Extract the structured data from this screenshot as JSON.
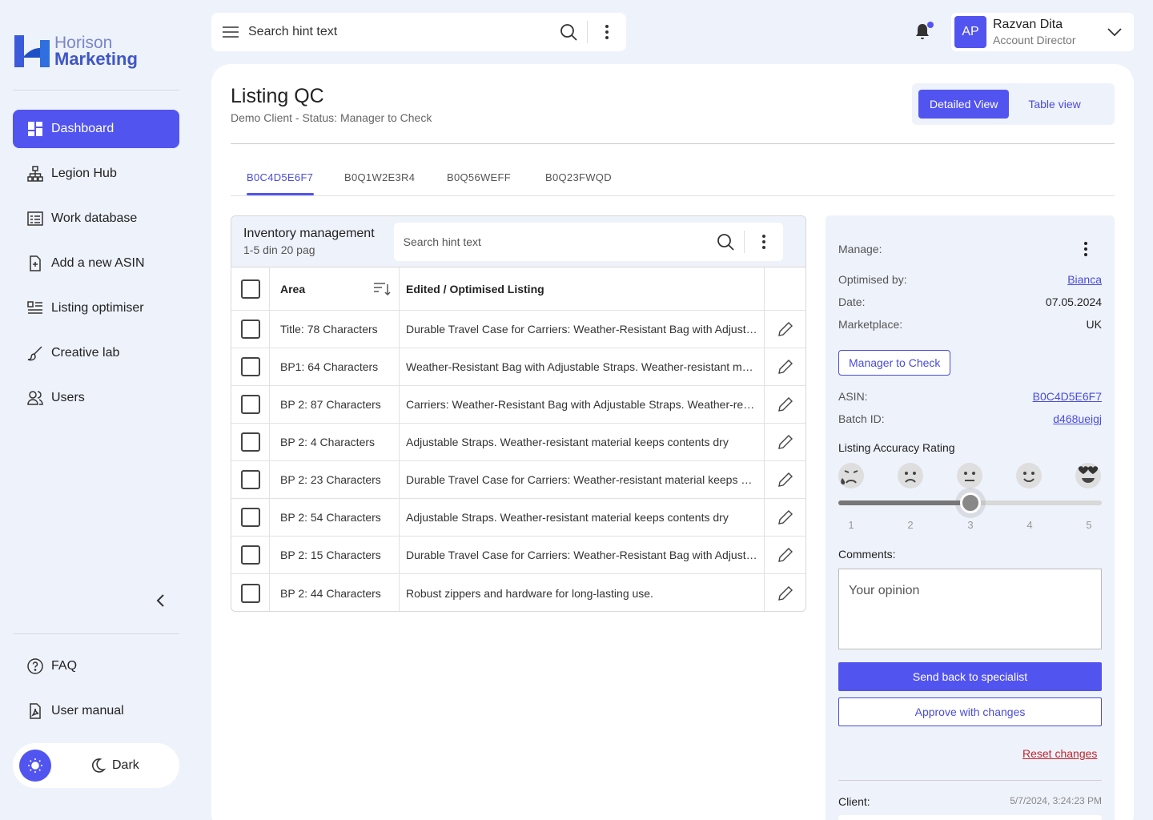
{
  "brand": {
    "line1": "Horison",
    "line2": "Marketing"
  },
  "sidebar": {
    "items": [
      {
        "label": "Dashboard",
        "icon": "dashboard-icon",
        "active": true
      },
      {
        "label": "Legion Hub",
        "icon": "hierarchy-icon"
      },
      {
        "label": "Work database",
        "icon": "database-icon"
      },
      {
        "label": "Add a new ASIN",
        "icon": "file-add-icon"
      },
      {
        "label": "Listing optimiser",
        "icon": "list-icon"
      },
      {
        "label": "Creative lab",
        "icon": "brush-icon"
      },
      {
        "label": "Users",
        "icon": "users-icon"
      }
    ],
    "bottom": [
      {
        "label": "FAQ",
        "icon": "help-icon"
      },
      {
        "label": "User manual",
        "icon": "pdf-icon"
      }
    ],
    "theme": {
      "dark_label": "Dark"
    }
  },
  "topbar": {
    "search_placeholder": "Search hint text",
    "user": {
      "initials": "AP",
      "name": "Razvan Dita",
      "role": "Account Director"
    }
  },
  "page": {
    "title": "Listing QC",
    "subtitle": "Demo Client - Status: Manager to Check",
    "views": {
      "detailed": "Detailed View",
      "table": "Table view"
    },
    "tabs": [
      "B0C4D5E6F7",
      "B0Q1W2E3R4",
      "B0Q56WEFF",
      "B0Q23FWQD"
    ]
  },
  "table": {
    "title": "Inventory management",
    "pagination": "1-5 din 20 pag",
    "search_placeholder": "Search hint text",
    "headers": {
      "area": "Area",
      "listing": "Edited / Optimised Listing"
    },
    "rows": [
      {
        "area": "Title: 78 Characters",
        "listing": "Durable Travel Case for Carriers: Weather-Resistant Bag with Adjustable Straps"
      },
      {
        "area": "BP1: 64 Characters",
        "listing": "Weather-Resistant Bag with Adjustable Straps. Weather-resistant material"
      },
      {
        "area": "BP 2: 87 Characters",
        "listing": "Carriers: Weather-Resistant Bag with Adjustable Straps. Weather-resistant"
      },
      {
        "area": "BP 2: 4 Characters",
        "listing": "Adjustable Straps. Weather-resistant material keeps contents dry"
      },
      {
        "area": "BP 2: 23 Characters",
        "listing": "Durable Travel Case for Carriers: Weather-resistant material keeps contents"
      },
      {
        "area": "BP 2: 54 Characters",
        "listing": "Adjustable Straps. Weather-resistant material keeps contents dry"
      },
      {
        "area": "BP 2: 15 Characters",
        "listing": "Durable Travel Case for Carriers: Weather-Resistant Bag with Adjustable"
      },
      {
        "area": "BP 2: 44 Characters",
        "listing": "Robust zippers and hardware for long-lasting use."
      }
    ]
  },
  "details": {
    "manage_label": "Manage:",
    "optimised_by_label": "Optimised by:",
    "optimised_by": "Bianca",
    "date_label": "Date:",
    "date": "07.05.2024",
    "marketplace_label": "Marketplace:",
    "marketplace": "UK",
    "status": "Manager to Check",
    "asin_label": "ASIN:",
    "asin": "B0C4D5E6F7",
    "batch_label": "Batch ID:",
    "batch": "d468ueigj",
    "rating_label": "Listing Accuracy Rating",
    "rating_value": 3,
    "rating_ticks": [
      "1",
      "2",
      "3",
      "4",
      "5"
    ],
    "comments_label": "Comments:",
    "comments_placeholder": "Your opinion",
    "send_back": "Send back to specialist",
    "approve": "Approve with changes",
    "reset": "Reset changes",
    "client_label": "Client:",
    "client_time": "5/7/2024, 3:24:23 PM"
  },
  "colors": {
    "accent": "#5254F0",
    "danger": "#C0262D",
    "panel": "#EEF2FB"
  }
}
